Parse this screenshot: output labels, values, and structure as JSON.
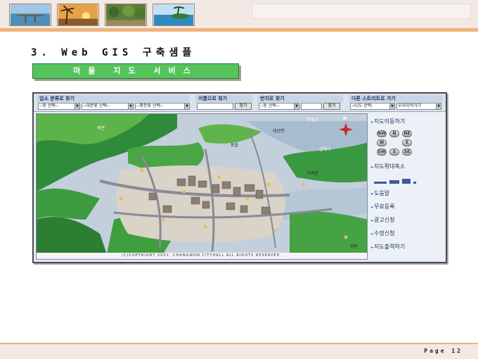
{
  "header": {
    "thumbnails": [
      "beach-pier-photo",
      "palm-sunset-photo",
      "tropical-forest-photo",
      "island-sea-photo"
    ]
  },
  "section_title": "3. Web GIS 구축샘플",
  "service_bar_label": "마을 지도 서비스",
  "app": {
    "toolbar": {
      "category_search": {
        "title": "업소 분류로 찾기",
        "select1": "--동 선택--",
        "select2": "--대분류 선택--",
        "select3": "--중분류 선택--"
      },
      "name_search": {
        "title": "이름으로 찾기",
        "button": "찾기"
      },
      "lot_search": {
        "title": "번지로 찾기",
        "select": "--동 선택--",
        "button": "찾기"
      },
      "other_street": {
        "title": "다른 스트리트로 가기",
        "select1": "-시/도 선택-",
        "select2": "우리지역가기"
      }
    },
    "map_labels": {
      "bangu": "방앗산",
      "daesan": "대산면",
      "gimhae": "김해시",
      "dongeup": "동읍",
      "north": "N",
      "bukmyeon": "북면",
      "sharp_art": "사격장",
      "hello": "양원"
    },
    "copyright": "(C)COPYRIGHT 2001, CHANGWON CITYHALL ALL RIGHTS RESERVED.",
    "side_menu": [
      "지도이동하기",
      "지도확대축소",
      "도움말",
      "무료등록",
      "광고신청",
      "수정신청",
      "지도출력하기"
    ],
    "direction_pad": [
      "N",
      "W",
      "E",
      "S",
      "NW",
      "NE",
      "SW",
      "SE"
    ]
  },
  "footer": {
    "page_label": "Page 12"
  },
  "colors": {
    "accent_green": "#55c45b",
    "header_orange": "#f0b37a",
    "header_pink": "#f3e9e4",
    "toolbar_blue": "#dbe3ee"
  }
}
